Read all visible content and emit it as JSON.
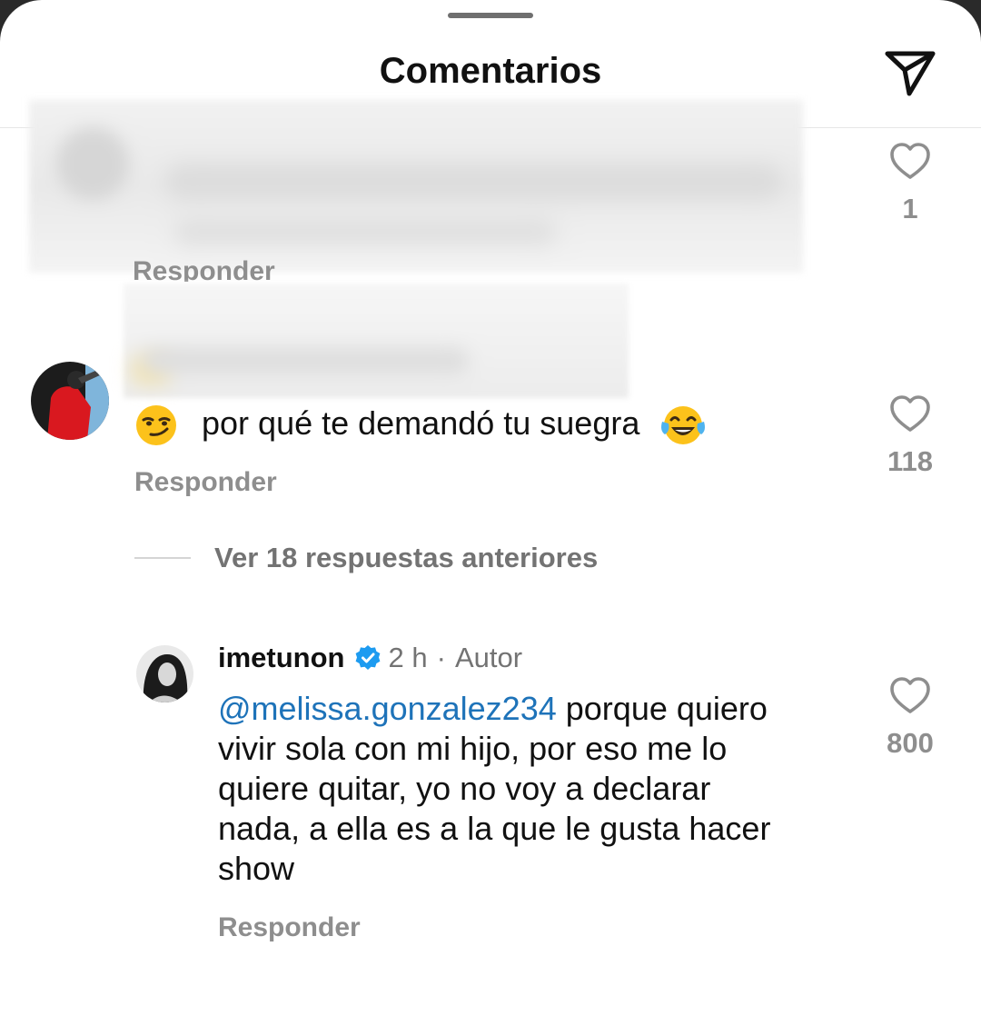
{
  "header": {
    "title": "Comentarios",
    "share_icon": "paper-plane-icon"
  },
  "comments": [
    {
      "blurred": true,
      "reply_label": "Responder",
      "likes": "1"
    },
    {
      "text": "por qué te demandó tu suegra",
      "leading_emoji": "smirking-face",
      "trailing_emoji": "face-with-tears-of-joy",
      "reply_label": "Responder",
      "likes": "118",
      "view_replies": "Ver 18 respuestas anteriores"
    }
  ],
  "reply": {
    "username": "imetunon",
    "verified": true,
    "time": "2 h",
    "separator": "·",
    "author_label": "Autor",
    "mention": "@melissa.gonzalez234",
    "lines": [
      "porque quiero",
      "vivir sola con mi hijo, por eso me lo",
      "quiere quitar, yo no voy a declarar",
      "nada, a ella es a la que le gusta hacer",
      "show"
    ],
    "reply_label": "Responder",
    "likes": "800"
  },
  "colors": {
    "mention": "#1e73b9",
    "verified_badge": "#1d9bf0",
    "secondary_text": "#8e8e8e"
  }
}
